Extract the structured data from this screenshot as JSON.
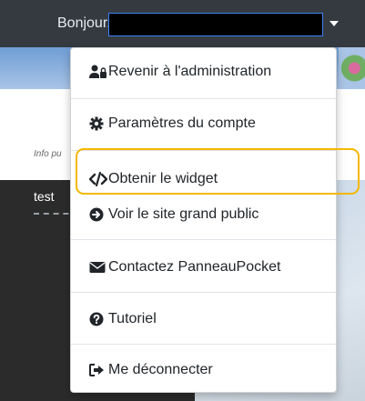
{
  "header": {
    "greeting": "Bonjour,"
  },
  "background": {
    "info_text": "Info pu",
    "panel_text": "test"
  },
  "menu": {
    "items": [
      {
        "label": "Revenir à l'administration",
        "icon": "users-cog-icon"
      },
      {
        "label": "Paramètres du compte",
        "icon": "gear-icon"
      },
      {
        "label": "Obtenir le widget",
        "icon": "code-icon"
      },
      {
        "label": "Voir le site grand public",
        "icon": "arrow-circle-right-icon"
      },
      {
        "label": "Contactez PanneauPocket",
        "icon": "envelope-icon"
      },
      {
        "label": "Tutoriel",
        "icon": "question-circle-icon"
      },
      {
        "label": "Me déconnecter",
        "icon": "sign-out-icon"
      }
    ]
  },
  "colors": {
    "navbar": "#343a40",
    "highlight": "#f5b700",
    "menu_text": "#212529"
  }
}
